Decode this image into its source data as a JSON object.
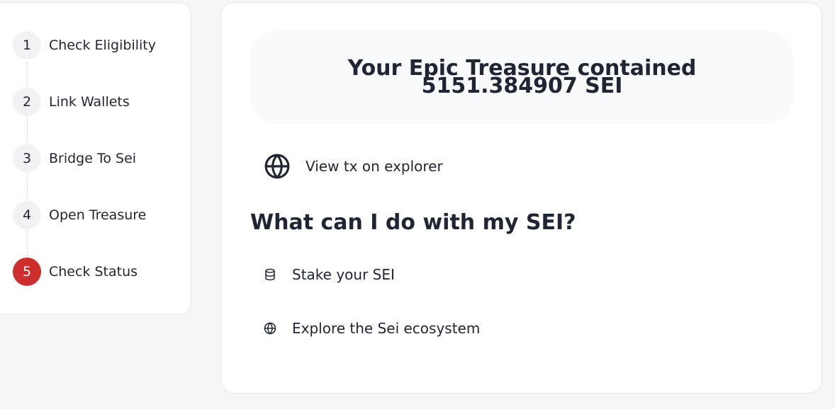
{
  "stepper": {
    "steps": [
      {
        "number": "1",
        "label": "Check Eligibility"
      },
      {
        "number": "2",
        "label": "Link Wallets"
      },
      {
        "number": "3",
        "label": "Bridge To Sei"
      },
      {
        "number": "4",
        "label": "Open Treasure"
      },
      {
        "number": "5",
        "label": "Check Status"
      }
    ],
    "active_step": 5,
    "active_color": "#cf2e2e"
  },
  "result": {
    "title": "Your Epic Treasure contained 5151.384907 SEI"
  },
  "explorer": {
    "icon": "globe-icon",
    "label": "View tx on explorer"
  },
  "next_steps": {
    "heading": "What can I do with my SEI?",
    "items": [
      {
        "icon": "database-icon",
        "label": "Stake your SEI"
      },
      {
        "icon": "globe-icon",
        "label": "Explore the Sei ecosystem"
      }
    ]
  }
}
